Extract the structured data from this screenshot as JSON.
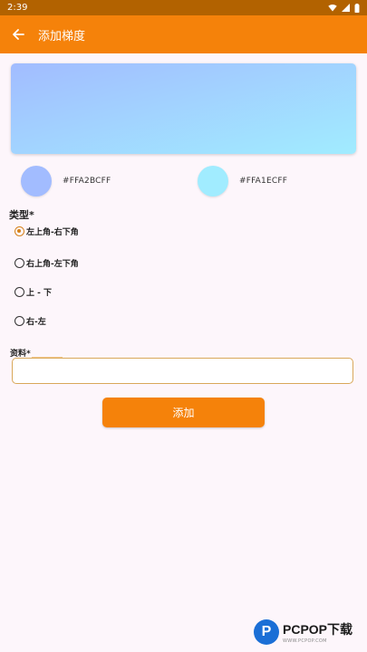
{
  "status_bar": {
    "time": "2:39",
    "icons": [
      "wifi-icon",
      "signal-icon",
      "battery-icon"
    ]
  },
  "app_bar": {
    "title": "添加梯度",
    "back_icon": "arrow-left-icon"
  },
  "colors": {
    "accent": "#F5820A",
    "status_bar": "#B26200",
    "background": "#FDF6FB",
    "field_border": "#D9A85A",
    "radio_selected": "#D5811A"
  },
  "gradient": {
    "start_color": "#A2BCFF",
    "end_color": "#A1ECFF",
    "start_label": "#FFA2BCFF",
    "end_label": "#FFA1ECFF"
  },
  "type_section": {
    "label": "类型*",
    "options": [
      {
        "label": "左上角-右下角",
        "checked": true
      },
      {
        "label": "右上角-左下角",
        "checked": false
      },
      {
        "label": "上 - 下",
        "checked": false
      },
      {
        "label": "右-左",
        "checked": false
      }
    ]
  },
  "data_field": {
    "label": "资料*",
    "value": "",
    "placeholder": ""
  },
  "add_button": {
    "label": "添加"
  },
  "watermark": {
    "logo_letter": "P",
    "main": "PCPOP下载",
    "sub": "WWW.PCPOP.COM"
  }
}
